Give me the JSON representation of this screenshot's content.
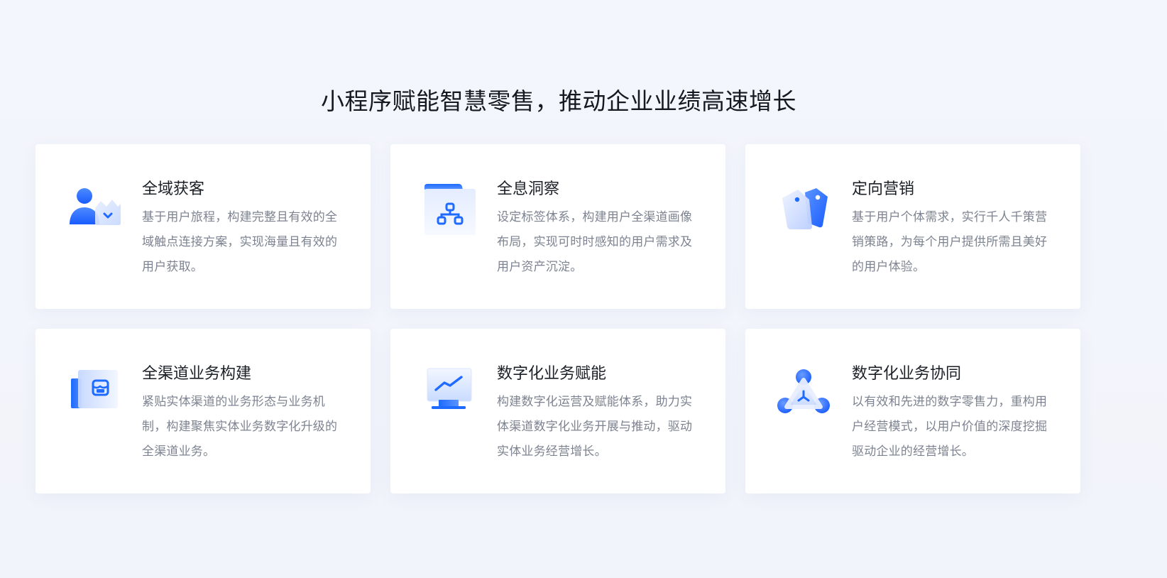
{
  "section": {
    "heading": "小程序赋能智慧零售，推动企业业绩高速增长"
  },
  "colors": {
    "accent": "#1f6bff",
    "card_bg": "#ffffff",
    "page_bg": "#f3f6fc",
    "title_text": "#1b1f26",
    "desc_text": "#7d8390"
  },
  "cards": [
    {
      "icon": "user-acquisition-icon",
      "title": "全域获客",
      "desc": "基于用户旅程，构建完整且有效的全域触点连接方案，实现海量且有效的用户获取。"
    },
    {
      "icon": "org-chart-insight-icon",
      "title": "全息洞察",
      "desc": "设定标签体系，构建用户全渠道画像布局，实现可时时感知的用户需求及用户资产沉淀。"
    },
    {
      "icon": "price-tag-icon",
      "title": "定向营销",
      "desc": "基于用户个体需求，实行千人千策营销策路，为每个用户提供所需且美好的用户体验。"
    },
    {
      "icon": "storefront-icon",
      "title": "全渠道业务构建",
      "desc": "紧贴实体渠道的业务形态与业务机制，构建聚焦实体业务数字化升级的全渠道业务。"
    },
    {
      "icon": "monitor-trend-icon",
      "title": "数字化业务赋能",
      "desc": "构建数字化运营及赋能体系，助力实体渠道数字化业务开展与推动，驱动实体业务经营增长。"
    },
    {
      "icon": "collaboration-network-icon",
      "title": "数字化业务协同",
      "desc": "以有效和先进的数字零售力，重构用户经营模式，以用户价值的深度挖掘驱动企业的经营增长。"
    }
  ]
}
